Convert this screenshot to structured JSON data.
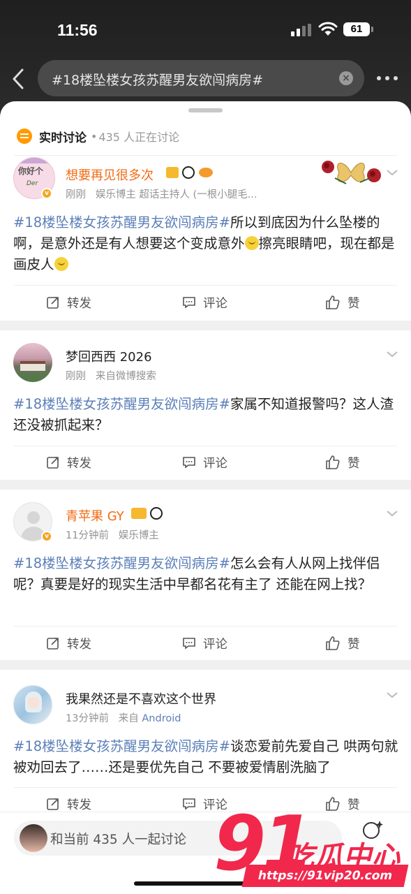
{
  "status_bar": {
    "time": "11:56",
    "battery": "61"
  },
  "search": {
    "query": "#18楼坠楼女孩苏醒男友欲闯病房#"
  },
  "live": {
    "title": "实时讨论",
    "dot": "•",
    "count_text": "435 人正在讨论"
  },
  "actions": {
    "repost": "转发",
    "comment": "评论",
    "like": "赞"
  },
  "posts": [
    {
      "username": "想要再见很多次",
      "time": "刚刚",
      "tags_line": "娱乐博主 超话主持人 (一根小腿毛...",
      "hashtag": "#18楼坠楼女孩苏醒男友欲闯病房#",
      "text_a": "所以到底因为什么坠楼的啊，是意外还是有人想要这个变成意外",
      "text_b": "擦亮眼睛吧，现在都是画皮人",
      "avatar_text": "你好个",
      "avatar_sub": "Der"
    },
    {
      "username": "梦回西西 2026",
      "time": "刚刚",
      "source": "来自微博搜索",
      "hashtag": "#18楼坠楼女孩苏醒男友欲闯病房#",
      "text_a": "家属不知道报警吗？这人渣还没被抓起来？"
    },
    {
      "username": "青苹果 GY",
      "time": "11分钟前",
      "tags_line": "娱乐博主",
      "hashtag": "#18楼坠楼女孩苏醒男友欲闯病房#",
      "text_a": "怎么会有人从网上找伴侣呢？真要是好的现实生活中早都名花有主了 还能在网上找？"
    },
    {
      "username": "我果然还是不喜欢这个世界",
      "time": "13分钟前",
      "source_prefix": "来自",
      "source_link": "Android",
      "hashtag": "#18楼坠楼女孩苏醒男友欲闯病房#",
      "text_a": "谈恋爱前先爱自己 哄两句就被劝回去了……还是要优先自己 不要被爱情剧洗脑了"
    }
  ],
  "compose": {
    "placeholder": "和当前 435 人一起讨论"
  },
  "watermark": {
    "number": "91",
    "name": "吃瓜中心",
    "url": "https://91vip20.com"
  },
  "colors": {
    "accent_orange": "#f26b15",
    "hashtag_blue": "#5b7fb8",
    "watermark_red": "#f1284c"
  }
}
